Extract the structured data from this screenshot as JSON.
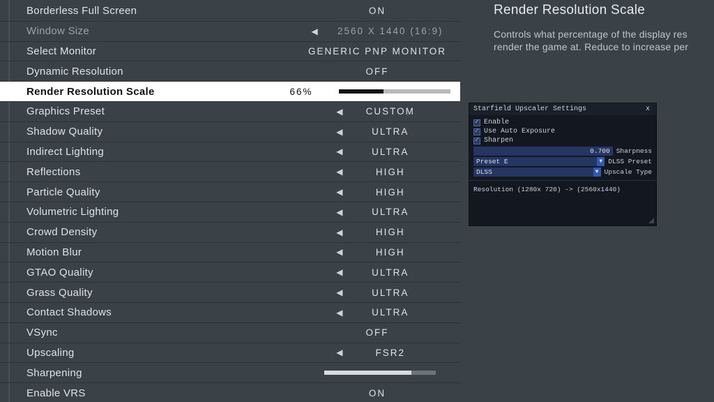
{
  "info": {
    "title": "Render Resolution Scale",
    "desc": "Controls what percentage of the display res\nrender the game at. Reduce to increase per"
  },
  "settings": [
    {
      "label": "Borderless Full Screen",
      "value": "ON",
      "arrows": false,
      "disabled": false
    },
    {
      "label": "Window Size",
      "value": "2560 X 1440 (16:9)",
      "arrows": true,
      "disabled": true
    },
    {
      "label": "Select Monitor",
      "value": "GENERIC PNP MONITOR",
      "arrows": false,
      "disabled": false
    },
    {
      "label": "Dynamic Resolution",
      "value": "OFF",
      "arrows": false,
      "disabled": false
    },
    {
      "label": "Render Resolution Scale",
      "value": "66%",
      "slider": true,
      "pct": 40,
      "selected": true
    },
    {
      "label": "Graphics Preset",
      "value": "CUSTOM",
      "arrows": true
    },
    {
      "label": "Shadow Quality",
      "value": "ULTRA",
      "arrows": true
    },
    {
      "label": "Indirect Lighting",
      "value": "ULTRA",
      "arrows": true
    },
    {
      "label": "Reflections",
      "value": "HIGH",
      "arrows": true
    },
    {
      "label": "Particle Quality",
      "value": "HIGH",
      "arrows": true
    },
    {
      "label": "Volumetric Lighting",
      "value": "ULTRA",
      "arrows": true
    },
    {
      "label": "Crowd Density",
      "value": "HIGH",
      "arrows": true
    },
    {
      "label": "Motion Blur",
      "value": "HIGH",
      "arrows": true
    },
    {
      "label": "GTAO Quality",
      "value": "ULTRA",
      "arrows": true
    },
    {
      "label": "Grass Quality",
      "value": "ULTRA",
      "arrows": true
    },
    {
      "label": "Contact Shadows",
      "value": "ULTRA",
      "arrows": true
    },
    {
      "label": "VSync",
      "value": "OFF",
      "arrows": false
    },
    {
      "label": "Upscaling",
      "value": "FSR2",
      "arrows": true
    },
    {
      "label": "Sharpening",
      "value": "",
      "slider": true,
      "alt": true,
      "pct": 78
    },
    {
      "label": "Enable VRS",
      "value": "ON",
      "arrows": false
    }
  ],
  "overlay": {
    "title": "Starfield Upscaler Settings",
    "checks": [
      {
        "label": "Enable"
      },
      {
        "label": "Use Auto Exposure"
      },
      {
        "label": "Sharpen"
      }
    ],
    "sharpness": {
      "value": "0.700",
      "label": "Sharpness"
    },
    "preset": {
      "value": "Preset E",
      "label": "DLSS Preset"
    },
    "upscale": {
      "value": "DLSS",
      "label": "Upscale Type"
    },
    "res": "Resolution (1280x 720) -> (2560x1440)"
  }
}
